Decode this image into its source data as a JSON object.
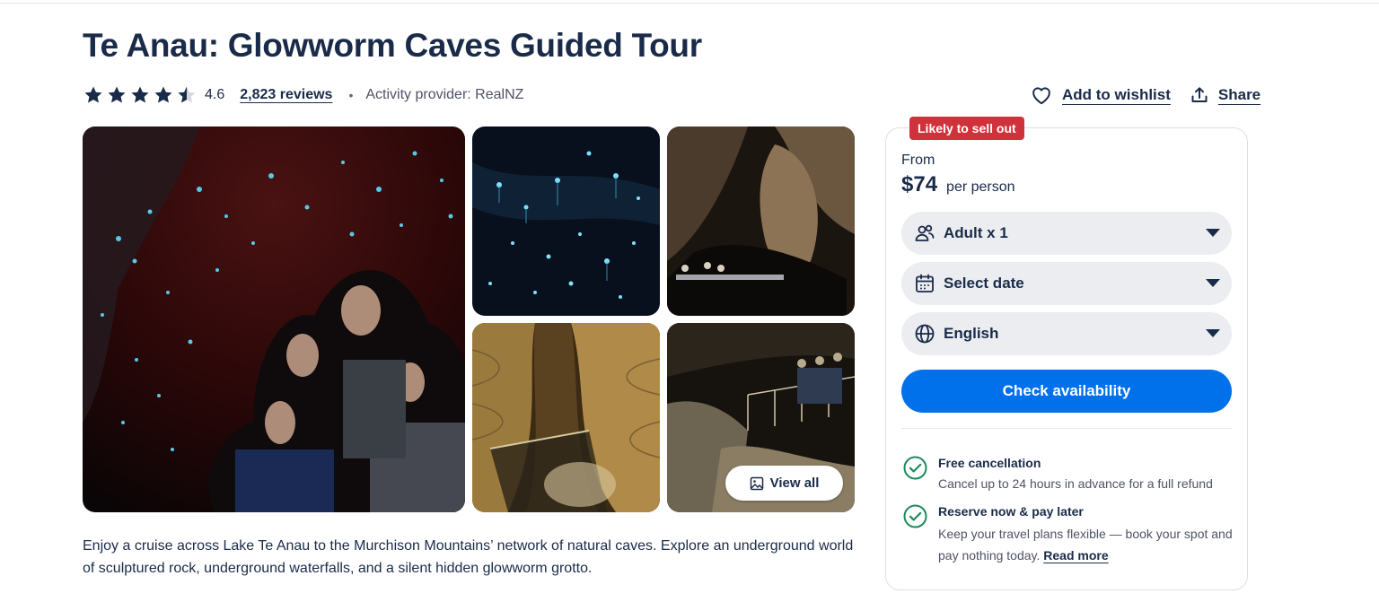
{
  "title": "Te Anau: Glowworm Caves Guided Tour",
  "rating": {
    "value": 4.6,
    "label": "4.6",
    "reviews": "2,823 reviews",
    "stars_filled": 4.6,
    "stars_max": 5
  },
  "separator": "•",
  "provider": "Activity provider: RealNZ",
  "header_actions": {
    "wishlist": "Add to wishlist",
    "share": "Share"
  },
  "gallery": {
    "view_all": "View all"
  },
  "description": "Enjoy a cruise across Lake Te Anau to the Murchison Mountains’ network of natural caves. Explore an underground world of sculptured rock, underground waterfalls, and a silent hidden glowworm grotto.",
  "booking": {
    "badge": "Likely to sell out",
    "from": "From",
    "price": "$74",
    "per": "per person",
    "participants": "Adult x 1",
    "date": "Select date",
    "language": "English",
    "cta": "Check availability",
    "benefits": [
      {
        "title": "Free cancellation",
        "desc": "Cancel up to 24 hours in advance for a full refund"
      },
      {
        "title": "Reserve now & pay later",
        "desc": "Keep your travel plans flexible — book your spot and pay nothing today.",
        "link": "Read more"
      }
    ]
  },
  "icons": {
    "star": "star-icon",
    "heart": "heart-icon",
    "share": "share-icon",
    "image": "image-icon",
    "participants": "people-icon",
    "calendar": "calendar-icon",
    "globe": "globe-icon",
    "caret": "caret-down-icon",
    "check": "check-circle-icon"
  },
  "colors": {
    "text": "#1a2b49",
    "primary": "#0071eb",
    "badge": "#d0323c",
    "check": "#1e8a5a",
    "field": "#ebedf0"
  }
}
